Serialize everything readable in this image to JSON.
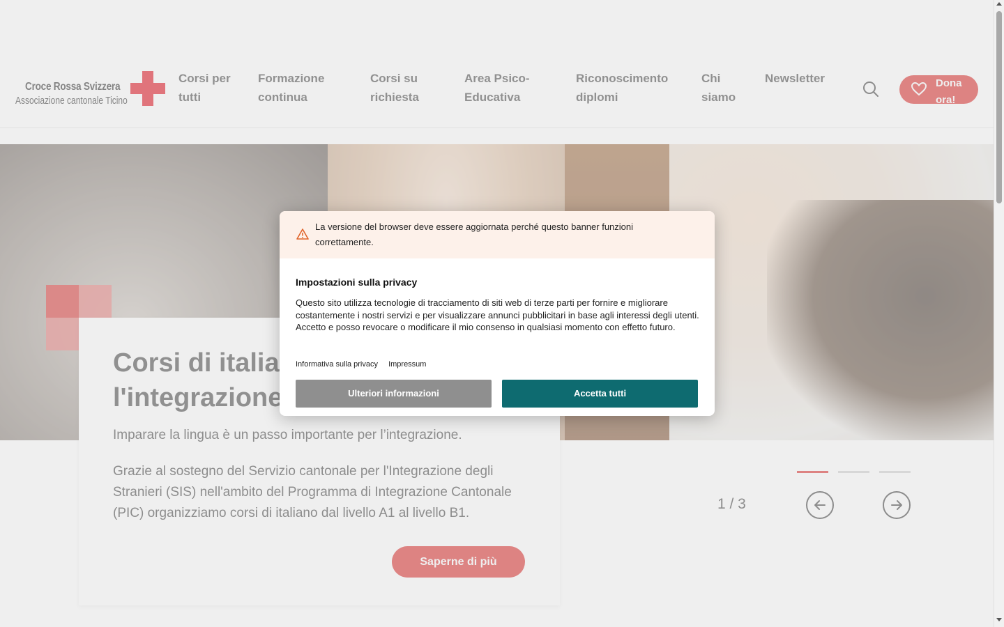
{
  "logo": {
    "line1": "Croce Rossa Svizzera",
    "line2": "Associazione cantonale Ticino",
    "cross_color": "#e1000f"
  },
  "nav": {
    "items": [
      {
        "line1": "Corsi per",
        "line2": "tutti"
      },
      {
        "line1": "Formazione",
        "line2": "continua"
      },
      {
        "line1": "Corsi su",
        "line2": "richiesta"
      },
      {
        "line1": "Area Psico-",
        "line2": "Educativa"
      },
      {
        "line1": "Riconoscimento",
        "line2": "diplomi"
      },
      {
        "line1": "Chi",
        "line2": "siamo"
      },
      {
        "line1": "Newsletter",
        "line2": ""
      }
    ],
    "search_icon": "search-icon",
    "donate_label_1": "Dona",
    "donate_label_2": "ora!",
    "donate_icon": "heart-icon"
  },
  "hero": {
    "title": "Corsi di italiano per la lingua e l'integrazione",
    "subtitle": "Imparare la lingua è un passo importante per l’integrazione.",
    "body": "Grazie al sostegno del Servizio cantonale per l'Integrazione degli Stranieri (SIS) nell'ambito del Programma di Integrazione Cantonale (PIC) organizziamo corsi di italiano dal livello A1 al livello B1.",
    "button": "Saperne di più",
    "accent_color": "#d9201e"
  },
  "slider": {
    "counter": "1 / 3",
    "total": 3,
    "active_index": 0,
    "prev_icon": "arrow-left-icon",
    "next_icon": "arrow-right-icon"
  },
  "consent": {
    "warning": "La versione del browser deve essere aggiornata perché questo banner funzioni correttamente.",
    "title": "Impostazioni sulla privacy",
    "body": "Questo sito utilizza tecnologie di tracciamento di siti web di terze parti per fornire e migliorare costantemente i nostri servizi e per visualizzare annunci pubblicitari in base agli interessi degli utenti. Accetto e posso revocare o modificare il mio consenso in qualsiasi momento con effetto futuro.",
    "link_privacy": "Informativa sulla privacy",
    "link_impressum": "Impressum",
    "btn_more": "Ulteriori informazioni",
    "btn_accept": "Accetta tutti",
    "accept_color": "#0e6b70",
    "more_color": "#8f8f8f",
    "warning_bg": "#fdf1ea"
  }
}
